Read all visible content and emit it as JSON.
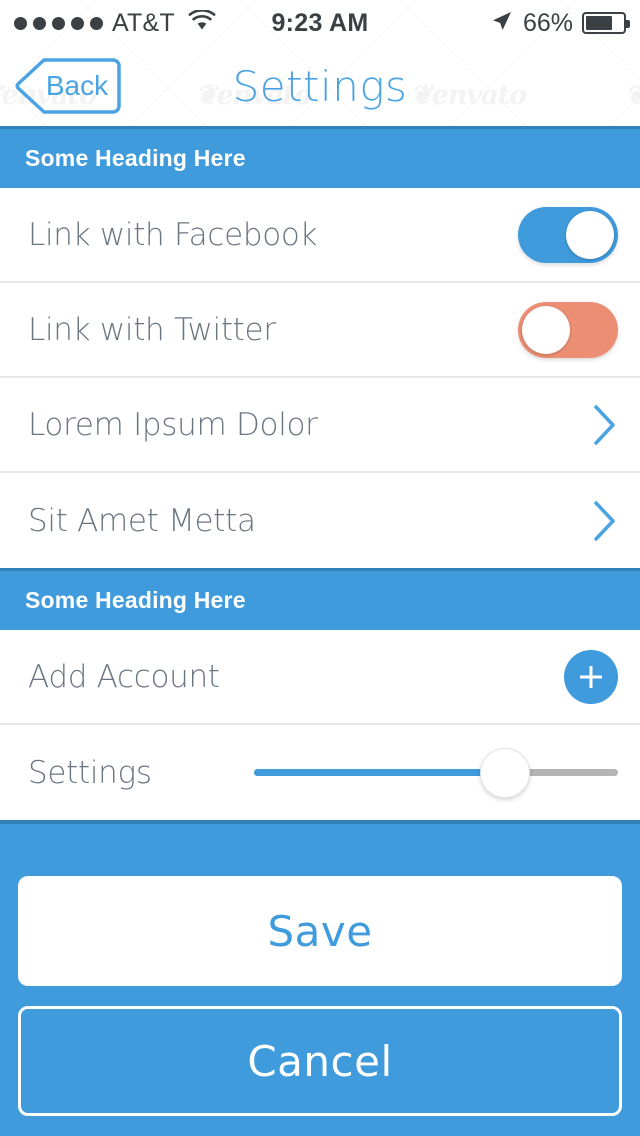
{
  "status_bar": {
    "signal_dots": 5,
    "carrier": "AT&T",
    "wifi_icon": "wifi-icon",
    "time": "9:23 AM",
    "location_icon": "location-arrow-icon",
    "battery_percent": "66%",
    "battery_level": 66
  },
  "nav_bar": {
    "back_label": "Back",
    "title": "Settings",
    "back_icon": "chevron-left-icon"
  },
  "sections": [
    {
      "heading": "Some Heading Here",
      "rows": [
        {
          "label": "Link with Facebook",
          "control": "toggle",
          "state": "on",
          "icon": "toggle-on-icon"
        },
        {
          "label": "Link with Twitter",
          "control": "toggle",
          "state": "off",
          "icon": "toggle-off-icon"
        },
        {
          "label": "Lorem Ipsum Dolor",
          "control": "chevron",
          "icon": "chevron-right-icon"
        },
        {
          "label": "Sit Amet Metta",
          "control": "chevron",
          "icon": "chevron-right-icon"
        }
      ]
    },
    {
      "heading": "Some Heading Here",
      "rows": [
        {
          "label": "Add Account",
          "control": "plus",
          "icon": "plus-icon"
        },
        {
          "label": "Settings",
          "control": "slider",
          "value": 69
        }
      ]
    }
  ],
  "footer": {
    "save_label": "Save",
    "cancel_label": "Cancel"
  },
  "colors": {
    "accent_blue": "#3f9bdc",
    "accent_blue_dark": "#3182b9",
    "toggle_off_salmon": "#ec8e73",
    "label_gray": "#6a7582",
    "divider_gray": "#e7e7e7",
    "white": "#ffffff"
  },
  "watermark": {
    "text": "envato"
  }
}
